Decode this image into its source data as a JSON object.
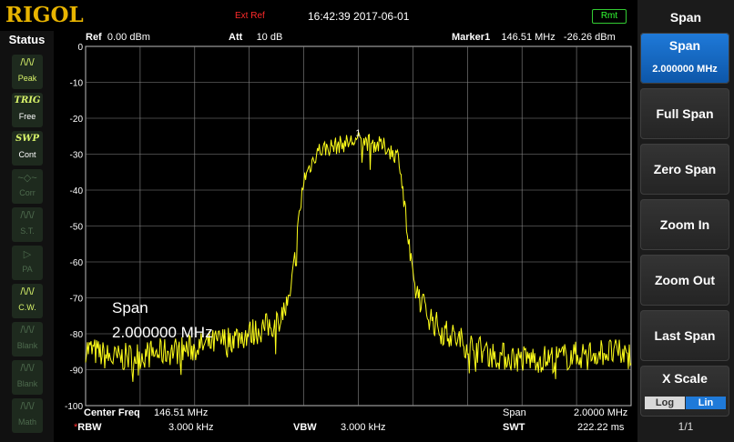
{
  "header": {
    "logo": "RIGOL",
    "ext_ref": "Ext Ref",
    "datetime": "16:42:39 2017-06-01",
    "remote": "Rmt"
  },
  "status_panel": {
    "title": "Status",
    "items": [
      {
        "icon": "peak-wave-icon",
        "glyph": "/\\/\\/",
        "label": "Peak",
        "state": "on"
      },
      {
        "icon": "trig-icon",
        "glyph": "TRIG",
        "label": "Free",
        "state": "on-white"
      },
      {
        "icon": "swp-icon",
        "glyph": "SWP",
        "label": "Cont",
        "state": "on-white"
      },
      {
        "icon": "corr-icon",
        "glyph": "~◇~",
        "label": "Corr",
        "state": "dim"
      },
      {
        "icon": "st-icon",
        "glyph": "/\\/\\/",
        "label": "S.T.",
        "state": "dim"
      },
      {
        "icon": "pa-icon",
        "glyph": "▷",
        "label": "PA",
        "state": "dim"
      },
      {
        "icon": "cw-icon",
        "glyph": "/\\/\\/",
        "label": "C.W.",
        "state": "on"
      },
      {
        "icon": "blank-icon",
        "glyph": "/\\/\\/",
        "label": "Blank",
        "state": "dim"
      },
      {
        "icon": "blank-icon",
        "glyph": "/\\/\\/",
        "label": "Blank",
        "state": "dim"
      },
      {
        "icon": "math-icon",
        "glyph": "/\\/\\/",
        "label": "Math",
        "state": "dim"
      }
    ]
  },
  "screen": {
    "ref_label": "Ref",
    "ref_value": "0.00 dBm",
    "att_label": "Att",
    "att_value": "10 dB",
    "marker_label": "Marker1",
    "marker_freq": "146.51 MHz",
    "marker_level": "-26.26 dBm",
    "marker_number": "1",
    "y_ticks": [
      "0",
      "-10",
      "-20",
      "-30",
      "-40",
      "-50",
      "-60",
      "-70",
      "-80",
      "-90",
      "-100"
    ],
    "overlay_title": "Span",
    "overlay_value": "2.000000 MHz",
    "trace_color": "#ffff1a"
  },
  "footer": {
    "center_freq_label": "Center Freq",
    "center_freq_value": "146.51 MHz",
    "span_label": "Span",
    "span_value": "2.0000 MHz",
    "rbw_star": "*",
    "rbw_label": "RBW",
    "rbw_value": "3.000 kHz",
    "vbw_label": "VBW",
    "vbw_value": "3.000 kHz",
    "swt_label": "SWT",
    "swt_value": "222.22 ms"
  },
  "softkeys": {
    "title": "Span",
    "span": {
      "label": "Span",
      "value": "2.000000 MHz"
    },
    "full_span": "Full Span",
    "zero_span": "Zero Span",
    "zoom_in": "Zoom In",
    "zoom_out": "Zoom Out",
    "last_span": "Last Span",
    "x_scale": {
      "label": "X Scale",
      "option_log": "Log",
      "option_lin": "Lin",
      "selected": "Lin"
    },
    "page": "1/1"
  },
  "chart_data": {
    "type": "line",
    "title": "",
    "xlabel": "",
    "ylabel": "",
    "x_range_mhz": [
      145.51,
      147.51
    ],
    "ylim": [
      -100,
      0
    ],
    "y_unit": "dBm",
    "grid": true,
    "series": [
      {
        "x_mhz": [
          145.51,
          145.61,
          145.71,
          145.81,
          145.91,
          146.01,
          146.11,
          146.21,
          146.26,
          146.31,
          146.36,
          146.41,
          146.46,
          146.51,
          146.56,
          146.61,
          146.66,
          146.71,
          146.76,
          146.81,
          146.91,
          147.01,
          147.11,
          147.21,
          147.31,
          147.41,
          147.51
        ],
        "values_dbm": [
          -84,
          -87,
          -86,
          -85,
          -84,
          -82,
          -80,
          -77,
          -71,
          -37,
          -29,
          -28,
          -27,
          -26,
          -27,
          -28,
          -31,
          -66,
          -74,
          -79,
          -83,
          -86,
          -87,
          -87,
          -86,
          -85,
          -86
        ]
      }
    ]
  }
}
